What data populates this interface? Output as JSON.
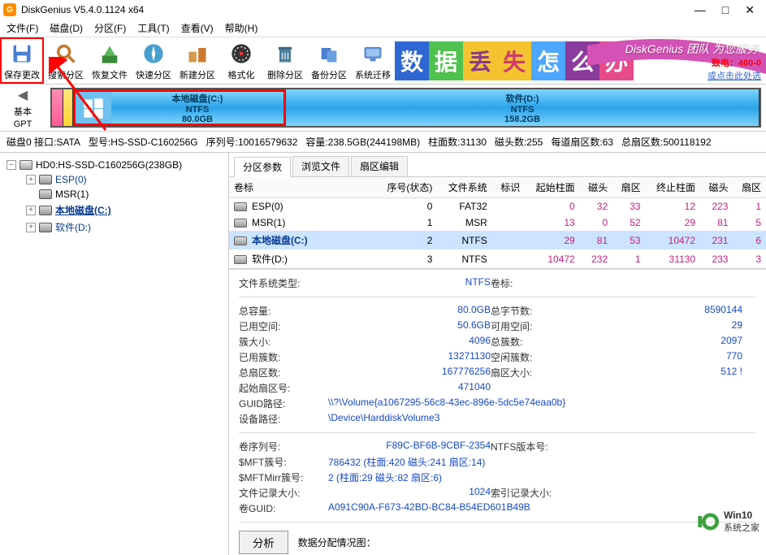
{
  "window": {
    "title": "DiskGenius V5.4.0.1124 x64",
    "app_icon_letter": "G"
  },
  "menu": {
    "file": "文件(F)",
    "disk": "磁盘(D)",
    "partition": "分区(F)",
    "tools": "工具(T)",
    "view": "查看(V)",
    "help": "帮助(H)"
  },
  "toolbar": {
    "save": "保存更改",
    "search": "搜索分区",
    "recover": "恢复文件",
    "quick": "快速分区",
    "new": "新建分区",
    "format": "格式化",
    "delete": "删除分区",
    "backup": "备份分区",
    "migrate": "系统迁移"
  },
  "banner": {
    "chars": [
      "数",
      "据",
      "丢",
      "失",
      "怎",
      "么",
      "办"
    ],
    "char_colors": [
      "#2e66d4",
      "#4fc14f",
      "#f4c430",
      "#f4c430",
      "#4da6ff",
      "#8b3a9e",
      "#e84b8a"
    ],
    "slogan": "DiskGenius 团队 为您服务",
    "tel_label": "致电：",
    "tel": "400-0",
    "link": "或点击此处选"
  },
  "diskmap": {
    "left_lab1": "基本",
    "left_lab2": "GPT",
    "c": {
      "name": "本地磁盘(C:)",
      "fs": "NTFS",
      "size": "80.0GB"
    },
    "d": {
      "name": "软件(D:)",
      "fs": "NTFS",
      "size": "158.2GB"
    }
  },
  "status": {
    "disk": "磁盘0 接口:SATA",
    "model": "型号:HS-SSD-C160256G",
    "serial": "序列号:10016579632",
    "capacity": "容量:238.5GB(244198MB)",
    "cyl": "柱面数:31130",
    "heads": "磁头数:255",
    "spt": "每道扇区数:63",
    "total": "总扇区数:500118192"
  },
  "tree": {
    "root": "HD0:HS-SSD-C160256G(238GB)",
    "items": [
      {
        "label": "ESP(0)",
        "blue": true
      },
      {
        "label": "MSR(1)",
        "blue": false
      },
      {
        "label": "本地磁盘(C:)",
        "blue": true,
        "selected": true
      },
      {
        "label": "软件(D:)",
        "blue": true
      }
    ]
  },
  "tabs": {
    "t0": "分区参数",
    "t1": "浏览文件",
    "t2": "扇区编辑"
  },
  "vtable": {
    "headers": {
      "name": "卷标",
      "idx": "序号(状态)",
      "fs": "文件系统",
      "label": "标识",
      "start_cyl": "起始柱面",
      "head": "磁头",
      "sector": "扇区",
      "end_cyl": "终止柱面",
      "head2": "磁头",
      "sector2": "扇区"
    },
    "rows": [
      {
        "name": "ESP(0)",
        "idx": "0",
        "fs": "FAT32",
        "sc": "0",
        "h": "32",
        "s": "33",
        "ec": "12",
        "h2": "223",
        "s2": "1"
      },
      {
        "name": "MSR(1)",
        "idx": "1",
        "fs": "MSR",
        "sc": "13",
        "h": "0",
        "s": "52",
        "ec": "29",
        "h2": "81",
        "s2": "5"
      },
      {
        "name": "本地磁盘(C:)",
        "idx": "2",
        "fs": "NTFS",
        "sc": "29",
        "h": "81",
        "s": "53",
        "ec": "10472",
        "h2": "231",
        "s2": "6",
        "sel": true,
        "blue": true
      },
      {
        "name": "软件(D:)",
        "idx": "3",
        "fs": "NTFS",
        "sc": "10472",
        "h": "232",
        "s": "1",
        "ec": "31130",
        "h2": "233",
        "s2": "3"
      }
    ]
  },
  "props": {
    "fstype_k": "文件系统类型:",
    "fstype_v": "NTFS",
    "vollabel_k": "卷标:",
    "cap_k": "总容量:",
    "cap_v": "80.0GB",
    "bytes_k": "总字节数:",
    "bytes_v": "8590144",
    "used_k": "已用空间:",
    "used_v": "50.6GB",
    "free_k": "可用空间:",
    "free_v": "29",
    "clus_k": "簇大小:",
    "clus_v": "4096",
    "totclus_k": "总簇数:",
    "totclus_v": "2097",
    "usedclus_k": "已用簇数:",
    "usedclus_v": "13271130",
    "freeclus_k": "空闲簇数:",
    "freeclus_v": "770",
    "totsec_k": "总扇区数:",
    "totsec_v": "167776256",
    "secsize_k": "扇区大小:",
    "secsize_v": "512 !",
    "startsec_k": "起始扇区号:",
    "startsec_v": "471040",
    "guidpath_k": "GUID路径:",
    "guidpath_v": "\\\\?\\Volume{a1067295-56c8-43ec-896e-5dc5e74eaa0b}",
    "devpath_k": "设备路径:",
    "devpath_v": "\\Device\\HarddiskVolume3",
    "volsn_k": "卷序列号:",
    "volsn_v": "F89C-BF6B-9CBF-2354",
    "ntfsver_k": "NTFS版本号:",
    "mft_k": "$MFT簇号:",
    "mft_v": "786432 (柱面:420 磁头:241 扇区:14)",
    "mftm_k": "$MFTMirr簇号:",
    "mftm_v": "2 (柱面:29 磁头:82 扇区:6)",
    "filerec_k": "文件记录大小:",
    "filerec_v": "1024",
    "idxrec_k": "索引记录大小:",
    "volguid_k": "卷GUID:",
    "volguid_v": "A091C90A-F673-42BD-BC84-B54ED601B49B",
    "analyze": "分析",
    "alloc_label": "数据分配情况图："
  },
  "watermark": {
    "l1": "Win10",
    "l2": "系统之家"
  }
}
